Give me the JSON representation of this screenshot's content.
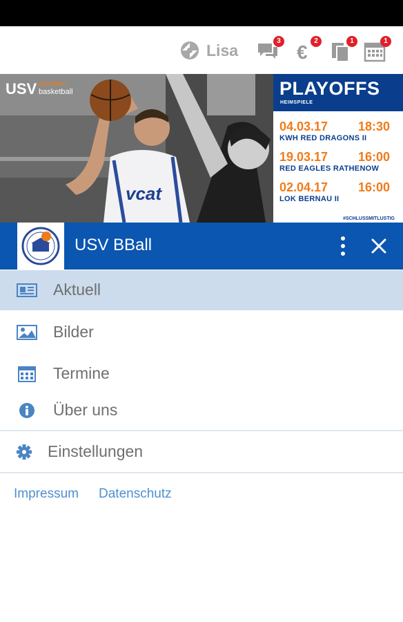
{
  "header": {
    "user_name": "Lisa",
    "icons": [
      {
        "name": "messages-icon",
        "badge": "3"
      },
      {
        "name": "euro-icon",
        "badge": "2"
      },
      {
        "name": "documents-icon",
        "badge": "1"
      },
      {
        "name": "calendar-icon",
        "badge": "1"
      }
    ]
  },
  "banner": {
    "logo_usv": "USV",
    "logo_potsdam": "potsdam",
    "logo_basketball": "basketball",
    "jersey_text": "vcat",
    "poster_title": "PLAYOFFS",
    "poster_subtitle": "HEIMSPIELE",
    "games": [
      {
        "date": "04.03.17",
        "time": "18:30",
        "team": "KWH RED DRAGONS II"
      },
      {
        "date": "19.03.17",
        "time": "16:00",
        "team": "RED EAGLES RATHENOW"
      },
      {
        "date": "02.04.17",
        "time": "16:00",
        "team": "LOK BERNAU II"
      }
    ],
    "hashtag": "#SCHLUSSMITLUSTIG"
  },
  "club": {
    "name": "USV BBall"
  },
  "nav": {
    "items": [
      {
        "label": "Aktuell",
        "icon": "newspaper-icon",
        "active": true
      },
      {
        "label": "Bilder",
        "icon": "image-icon",
        "active": false
      },
      {
        "label": "Termine",
        "icon": "calendar-icon",
        "active": false
      },
      {
        "label": "Über uns",
        "icon": "info-icon",
        "active": false
      }
    ],
    "settings_label": "Einstellungen"
  },
  "footer": {
    "impressum": "Impressum",
    "datenschutz": "Datenschutz"
  },
  "colors": {
    "primary": "#0a56b0",
    "poster_blue": "#0a3e8c",
    "accent_orange": "#f07b1a",
    "active_bg": "#ccdced",
    "icon_blue": "#4a84c4",
    "badge_red": "#e0202a"
  }
}
